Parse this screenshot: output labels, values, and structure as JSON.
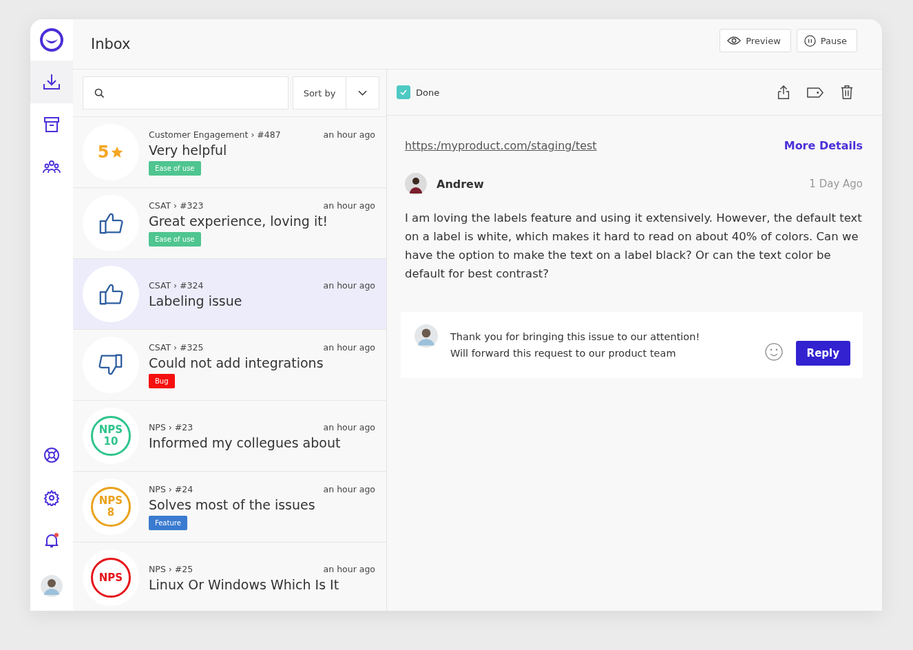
{
  "sidebar": {
    "nav": [
      {
        "kind": "inbox",
        "selected": true
      },
      {
        "kind": "archive",
        "selected": false
      },
      {
        "kind": "team",
        "selected": false
      }
    ],
    "bottom": [
      {
        "kind": "help"
      },
      {
        "kind": "settings"
      },
      {
        "kind": "notifications"
      },
      {
        "kind": "avatar"
      }
    ]
  },
  "header": {
    "title": "Inbox",
    "buttons": [
      {
        "kind": "preview",
        "label": "Preview"
      },
      {
        "kind": "pause",
        "label": "Pause"
      }
    ]
  },
  "list": {
    "sort_label": "Sort by",
    "items": [
      {
        "badge": {
          "kind": "rating",
          "text": "5"
        },
        "source": "Customer Engagement › #487",
        "time": "an hour ago",
        "title": "Very helpful",
        "tag": {
          "label": "Ease of use",
          "color": "#4fc590"
        },
        "selected": false
      },
      {
        "badge": {
          "kind": "thumbs_up"
        },
        "source": "CSAT › #323",
        "time": "an hour ago",
        "title": "Great experience, loving it!",
        "tag": {
          "label": "Ease of use",
          "color": "#4fc590"
        },
        "selected": false
      },
      {
        "badge": {
          "kind": "thumbs_up"
        },
        "source": "CSAT › #324",
        "time": "an hour ago",
        "title": "Labeling issue",
        "selected": true
      },
      {
        "badge": {
          "kind": "thumbs_down"
        },
        "source": "CSAT › #325",
        "time": "an hour ago",
        "title": "Could not add integrations",
        "tag": {
          "label": "Bug",
          "color": "#f50f0f"
        },
        "selected": false
      },
      {
        "badge": {
          "kind": "nps",
          "text": "NPS",
          "score": "10",
          "color": "#2fc48d"
        },
        "source": "NPS › #23",
        "time": "an hour ago",
        "title": "Informed my collegues about",
        "selected": false
      },
      {
        "badge": {
          "kind": "nps",
          "text": "NPS",
          "score": "8",
          "color": "#e9a21b"
        },
        "source": "NPS › #24",
        "time": "an hour ago",
        "title": "Solves most of the issues",
        "tag": {
          "label": "Feature",
          "color": "#3a7bd0"
        },
        "selected": false
      },
      {
        "badge": {
          "kind": "nps",
          "text": "NPS",
          "color": "#e5141a"
        },
        "source": "NPS › #25",
        "time": "an hour ago",
        "title": "Linux Or Windows Which Is It",
        "selected": false
      }
    ]
  },
  "detail": {
    "done": {
      "label": "Done",
      "checked": true
    },
    "actions": [
      {
        "kind": "share"
      },
      {
        "kind": "tag"
      },
      {
        "kind": "delete"
      }
    ],
    "url": "https:/myproduct.com/staging/test",
    "more_link": "More Details",
    "author": "Andrew",
    "time": "1 Day Ago",
    "message": "I am loving the labels feature and using it extensively.  However, the default text on a label is white, which makes it hard to read on about 40% of colors.  Can we have the option to make the text on a label black? Or can the text color be default for best contrast?",
    "reply": {
      "value": "Thank you for bringing this issue to our attention!\nWill forward this request to our product team",
      "button": "Reply"
    }
  }
}
